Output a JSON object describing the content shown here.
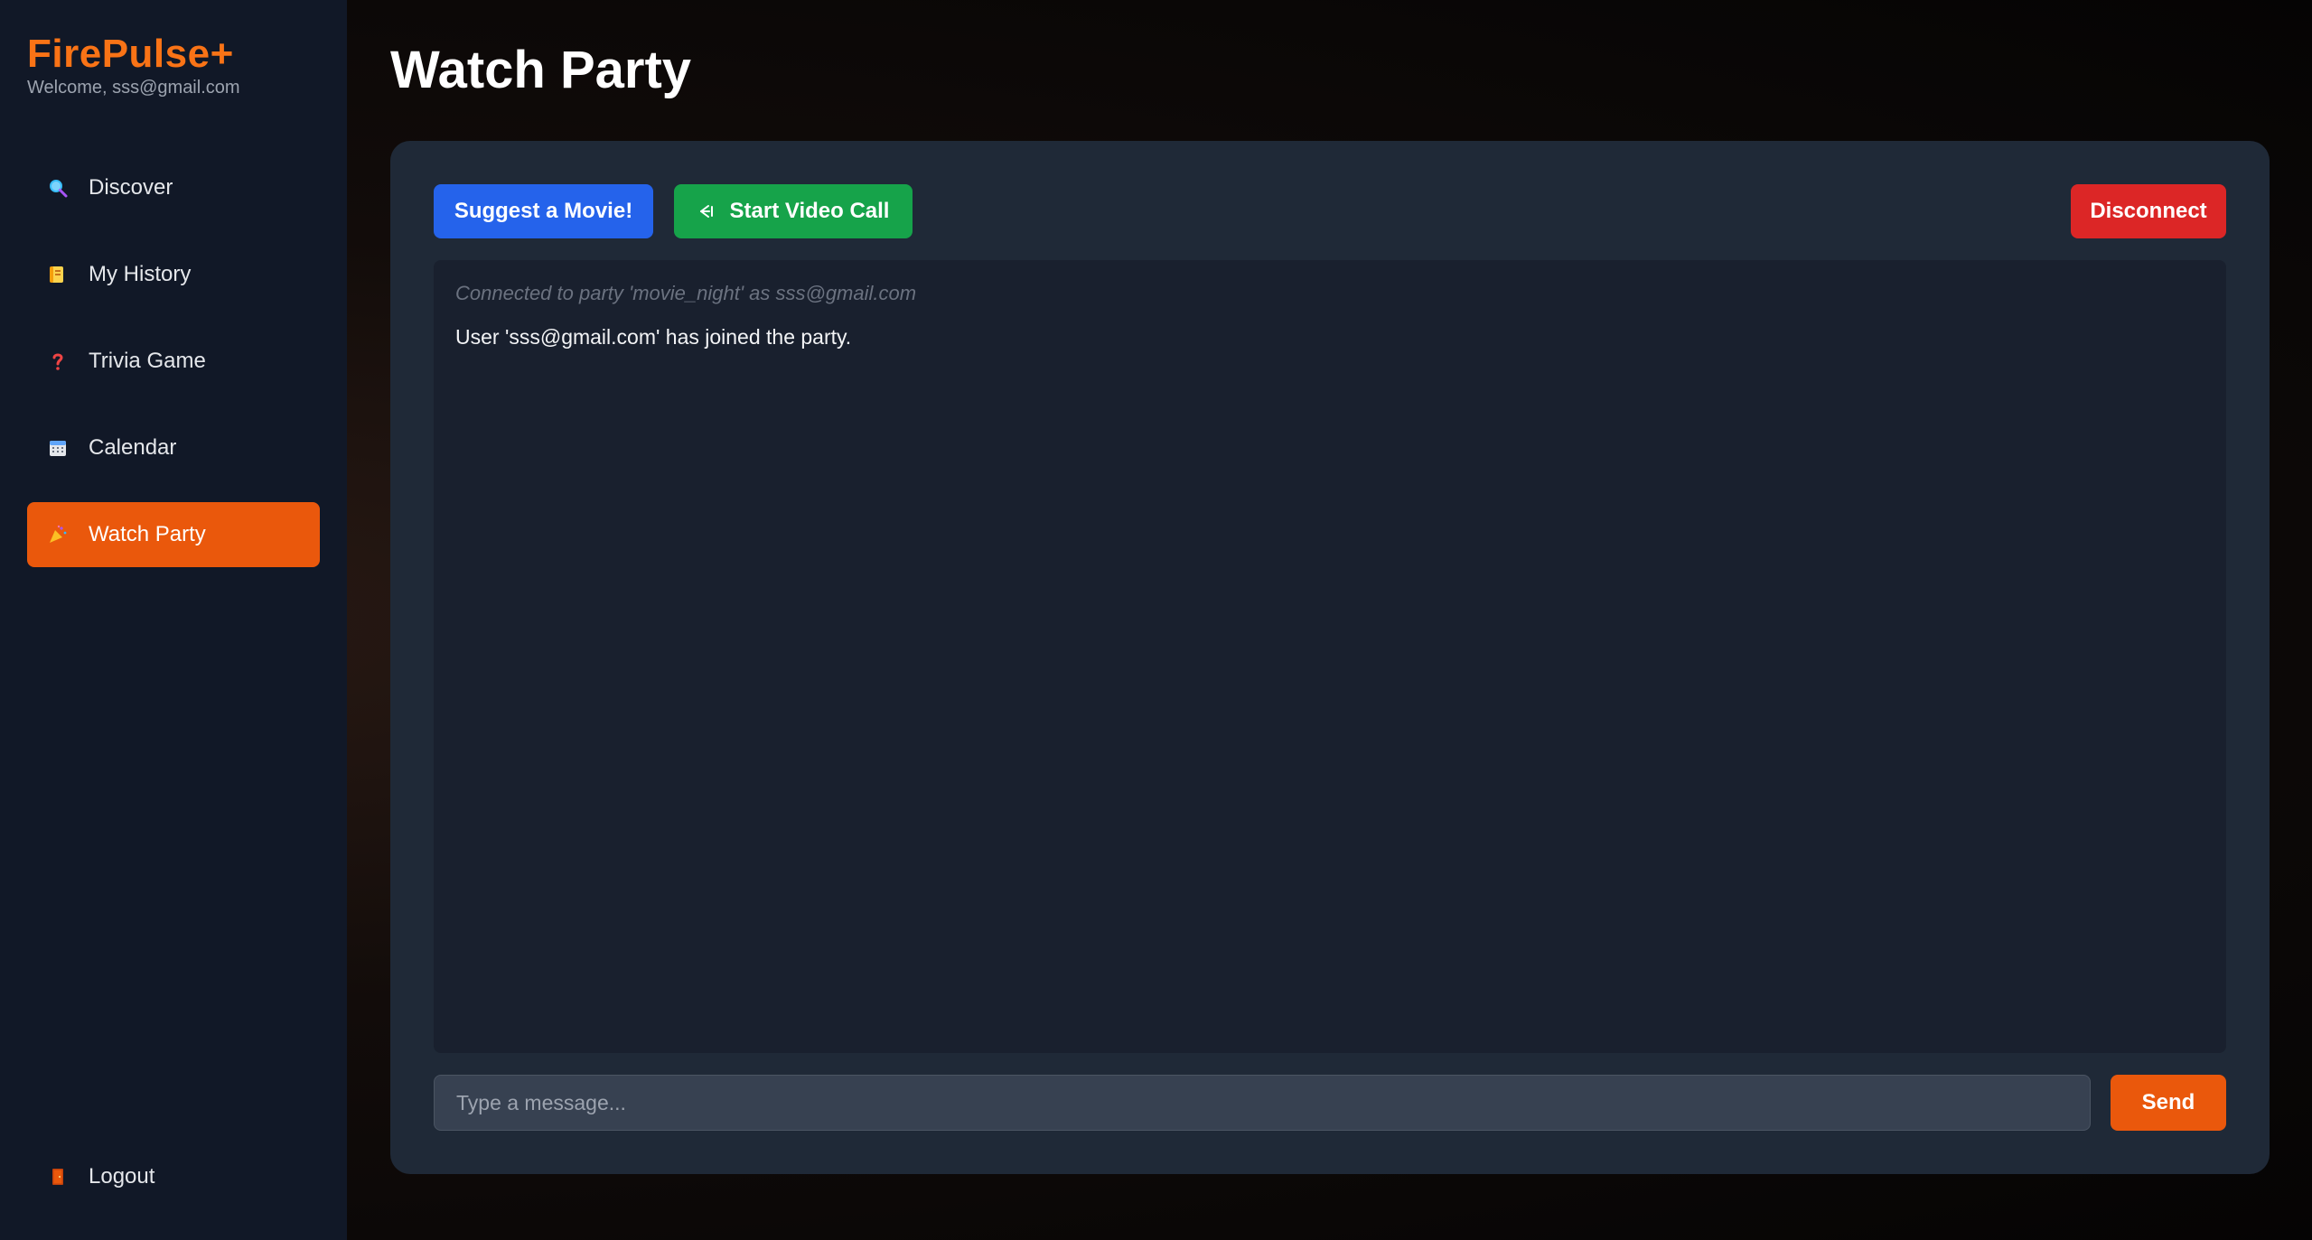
{
  "brand": {
    "title": "FirePulse+",
    "welcome": "Welcome, sss@gmail.com"
  },
  "sidebar": {
    "items": [
      {
        "label": "Discover",
        "icon": "magnifier-icon",
        "active": false
      },
      {
        "label": "My History",
        "icon": "scroll-icon",
        "active": false
      },
      {
        "label": "Trivia Game",
        "icon": "question-mark-icon",
        "active": false
      },
      {
        "label": "Calendar",
        "icon": "calendar-icon",
        "active": false
      },
      {
        "label": "Watch Party",
        "icon": "party-popper-icon",
        "active": true
      }
    ],
    "logout": {
      "label": "Logout",
      "icon": "door-icon"
    }
  },
  "main": {
    "title": "Watch Party",
    "buttons": {
      "suggest": "Suggest a Movie!",
      "video_call": "Start Video Call",
      "disconnect": "Disconnect",
      "send": "Send"
    },
    "chat": {
      "system_message": "Connected to party 'movie_night' as sss@gmail.com",
      "messages": [
        "User 'sss@gmail.com' has joined the party."
      ]
    },
    "input": {
      "placeholder": "Type a message...",
      "value": ""
    }
  },
  "colors": {
    "accent": "#ea580c",
    "brand": "#f97316",
    "suggest": "#2563eb",
    "call": "#16a34a",
    "disconnect": "#dc2626"
  }
}
